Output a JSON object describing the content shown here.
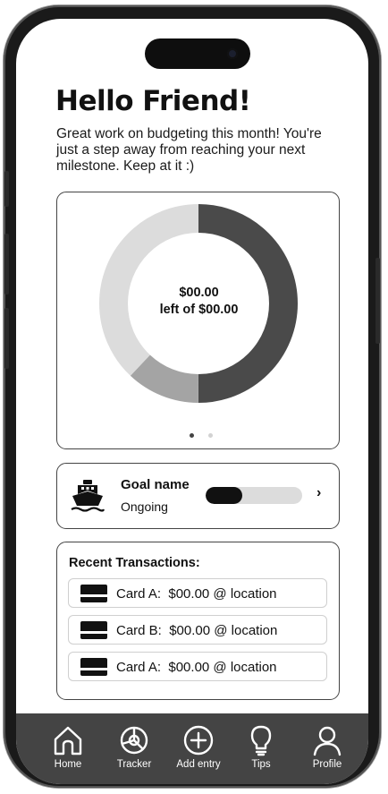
{
  "header": {
    "greeting": "Hello Friend!",
    "message": "Great work on budgeting this month! You're just a step away from reaching your next milestone. Keep at it :)"
  },
  "budget_summary": {
    "amount_left": "$00.00",
    "caption": "left of $00.00",
    "segments": [
      {
        "share": 0.5,
        "color": "#4a4a4a"
      },
      {
        "share": 0.12,
        "color": "#a4a4a4"
      },
      {
        "share": 0.38,
        "color": "#dcdcdc"
      }
    ],
    "carousel": {
      "total": 2,
      "active": 0
    }
  },
  "goal": {
    "name": "Goal name",
    "status": "Ongoing",
    "progress": 0.38,
    "icon": "ship-icon"
  },
  "transactions": {
    "title": "Recent Transactions:",
    "items": [
      {
        "card": "Card A:",
        "details": "$00.00 @ location"
      },
      {
        "card": "Card B:",
        "details": "$00.00 @ location"
      },
      {
        "card": "Card A:",
        "details": "$00.00 @ location"
      }
    ]
  },
  "tabbar": {
    "items": [
      {
        "label": "Home",
        "icon": "home-icon"
      },
      {
        "label": "Tracker",
        "icon": "pie-chart-icon"
      },
      {
        "label": "Add entry",
        "icon": "plus-circle-icon"
      },
      {
        "label": "Tips",
        "icon": "lightbulb-icon"
      },
      {
        "label": "Profile",
        "icon": "user-icon"
      }
    ]
  },
  "colors": {
    "tabbar_bg": "#444444",
    "accent_dark": "#111111",
    "track": "#dcdcdc"
  }
}
